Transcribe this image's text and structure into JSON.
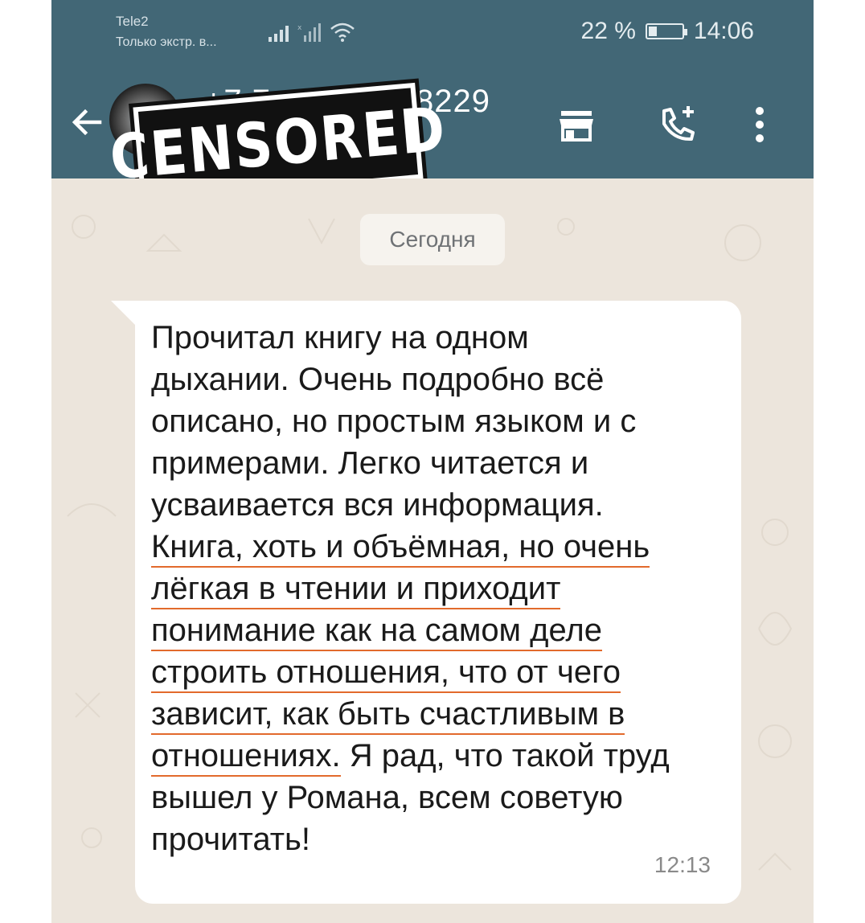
{
  "status_bar": {
    "carrier": "Tele2",
    "carrier_sub": "Только экстр. в...",
    "battery_percent": "22 %",
    "time": "14:06"
  },
  "header": {
    "contact_number_left": "+7 7",
    "contact_number_right": "8229",
    "censored_label": "CENSORED",
    "icons": [
      "back-arrow-icon",
      "store-icon",
      "add-call-icon",
      "more-vert-icon"
    ]
  },
  "chat": {
    "date_chip": "Сегодня",
    "message": {
      "lines": [
        "Прочитал книгу на одном",
        "дыхании. Очень подробно всё",
        "описано, но простым языком и с",
        "примерами. Легко читается и",
        "усваивается вся информация.",
        "Книга, хоть и объёмная, но очень",
        "лёгкая в чтении и приходит",
        "понимание как на самом деле",
        "строить отношения, что от чего",
        "зависит, как быть счастливым в",
        "отношениях.",
        "Я рад, что такой труд",
        "вышел у Романа, всем советую",
        "прочитать!"
      ],
      "time": "12:13"
    }
  },
  "colors": {
    "header_bg": "#426776",
    "chat_bg": "#ece5dc",
    "bubble_bg": "#ffffff",
    "underline": "#e26a2c"
  }
}
